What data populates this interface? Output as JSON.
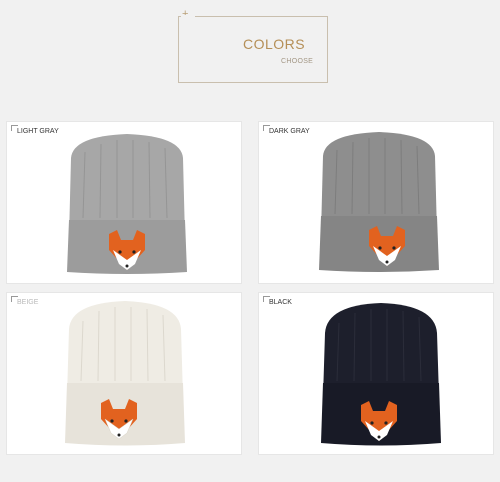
{
  "header": {
    "plus": "+",
    "title": "COLORS",
    "subtitle": "CHOOSE"
  },
  "variants": [
    {
      "label": "LIGHT GRAY",
      "color": "#a3a3a3",
      "label_color": "#555555"
    },
    {
      "label": "DARK GRAY",
      "color": "#8b8b8b",
      "label_color": "#333333"
    },
    {
      "label": "BEIGE",
      "color": "#eeebe3",
      "label_color": "#b9b9b9"
    },
    {
      "label": "BLACK",
      "color": "#1a1b28",
      "label_color": "#222222"
    }
  ]
}
